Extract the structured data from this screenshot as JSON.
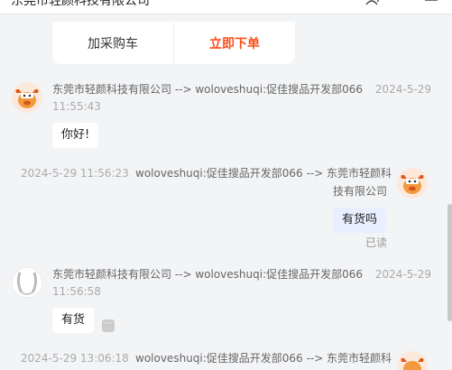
{
  "header": {
    "title": "东莞市轻颜科技有限公司",
    "icons": [
      "add-user-icon",
      "more-icon",
      "menu-icon"
    ]
  },
  "product_card": {
    "cart_label": "加采购车",
    "buy_label": "立即下单"
  },
  "messages": [
    {
      "direction": "received",
      "sender_line": "东莞市轻颜科技有限公司 --> woloveshuqi:促佳搜品开发部066",
      "date": "2024-5-29",
      "time": "11:55:43",
      "text": "你好!"
    },
    {
      "direction": "sent",
      "timestamp": "2024-5-29 11:56:23",
      "sender_line_1": "woloveshuqi:促佳搜品开发部066 --> 东莞市轻颜科",
      "sender_line_2": "技有限公司",
      "text": "有货吗",
      "status": "已读"
    },
    {
      "direction": "received",
      "sender_line": "东莞市轻颜科技有限公司 --> woloveshuqi:促佳搜品开发部066",
      "date": "2024-5-29",
      "time": "11:56:58",
      "text": "有货",
      "more_label": "···"
    },
    {
      "direction": "sent",
      "timestamp": "2024-5-29 13:06:18",
      "sender_line_1": "woloveshuqi:促佳搜品开发部066 --> 东莞市轻颜科"
    }
  ],
  "colors": {
    "accent": "#ff4d1a",
    "sent_bubble": "#e8f0ff",
    "background": "#f3f4f6"
  }
}
